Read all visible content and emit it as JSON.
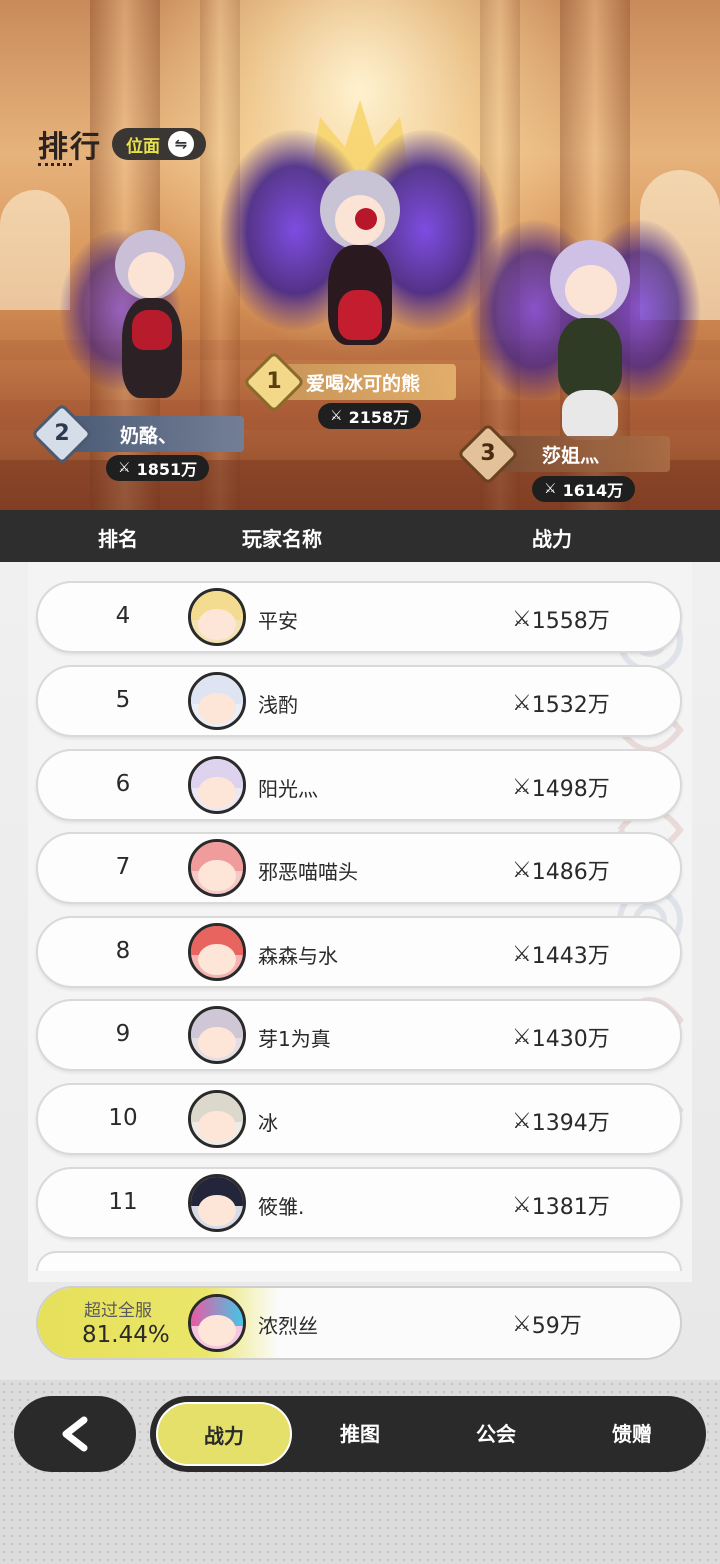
{
  "header": {
    "title": "排行",
    "realm_button_label": "位面",
    "swap_icon": "⇋"
  },
  "podium": [
    {
      "rank": "1",
      "name": "爱喝冰可的熊",
      "power": "2158万"
    },
    {
      "rank": "2",
      "name": "奶酪、",
      "power": "1851万"
    },
    {
      "rank": "3",
      "name": "莎姐灬",
      "power": "1614万"
    }
  ],
  "columns": {
    "rank": "排名",
    "player": "玩家名称",
    "power": "战力"
  },
  "rows": [
    {
      "rank": "4",
      "name": "平安",
      "power": "1558万"
    },
    {
      "rank": "5",
      "name": "浅酌",
      "power": "1532万"
    },
    {
      "rank": "6",
      "name": "阳光灬",
      "power": "1498万"
    },
    {
      "rank": "7",
      "name": "邪恶喵喵头",
      "power": "1486万"
    },
    {
      "rank": "8",
      "name": "森森与水",
      "power": "1443万"
    },
    {
      "rank": "9",
      "name": "芽1为真",
      "power": "1430万"
    },
    {
      "rank": "10",
      "name": "冰",
      "power": "1394万"
    },
    {
      "rank": "11",
      "name": "筱雏.",
      "power": "1381万"
    }
  ],
  "my_rank": {
    "exceed_label": "超过全服",
    "percent": "81.44%",
    "name": "浓烈丝",
    "power": "59万"
  },
  "tabs": [
    {
      "label": "战力",
      "active": true
    },
    {
      "label": "推图",
      "active": false
    },
    {
      "label": "公会",
      "active": false
    },
    {
      "label": "馈赠",
      "active": false
    }
  ],
  "icons": {
    "power": "swords-icon",
    "back": "chevron-left-icon"
  },
  "colors": {
    "accent_yellow": "#e5e06a",
    "dark": "#2a2a2a",
    "gold": "#e8c66a"
  }
}
